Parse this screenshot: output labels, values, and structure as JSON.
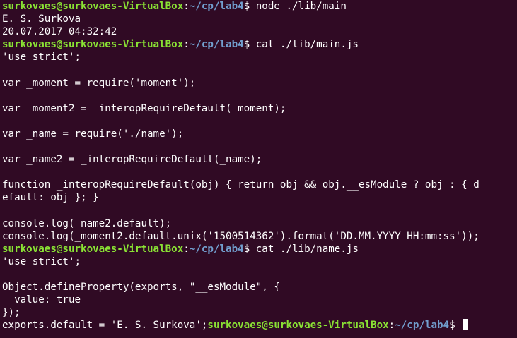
{
  "terminal": {
    "prompt": {
      "user_host": "surkovaes@surkovaes-VirtualBox",
      "path": "~/cp/lab4"
    },
    "lines": [
      {
        "type": "prompt",
        "cmd": "node ./lib/main"
      },
      {
        "type": "output",
        "text": "E. S. Surkova"
      },
      {
        "type": "output",
        "text": "20.07.2017 04:32:42"
      },
      {
        "type": "prompt",
        "cmd": "cat ./lib/main.js"
      },
      {
        "type": "output",
        "text": "'use strict';"
      },
      {
        "type": "output",
        "text": ""
      },
      {
        "type": "output",
        "text": "var _moment = require('moment');"
      },
      {
        "type": "output",
        "text": ""
      },
      {
        "type": "output",
        "text": "var _moment2 = _interopRequireDefault(_moment);"
      },
      {
        "type": "output",
        "text": ""
      },
      {
        "type": "output",
        "text": "var _name = require('./name');"
      },
      {
        "type": "output",
        "text": ""
      },
      {
        "type": "output",
        "text": "var _name2 = _interopRequireDefault(_name);"
      },
      {
        "type": "output",
        "text": ""
      },
      {
        "type": "output",
        "text": "function _interopRequireDefault(obj) { return obj && obj.__esModule ? obj : { d"
      },
      {
        "type": "output",
        "text": "efault: obj }; }"
      },
      {
        "type": "output",
        "text": ""
      },
      {
        "type": "output",
        "text": "console.log(_name2.default);"
      },
      {
        "type": "output",
        "text": "console.log(_moment2.default.unix('1500514362').format('DD.MM.YYYY HH:mm:ss'));"
      },
      {
        "type": "prompt",
        "cmd": "cat ./lib/name.js"
      },
      {
        "type": "output",
        "text": "'use strict';"
      },
      {
        "type": "output",
        "text": ""
      },
      {
        "type": "output",
        "text": "Object.defineProperty(exports, \"__esModule\", {"
      },
      {
        "type": "output",
        "text": "  value: true"
      },
      {
        "type": "output",
        "text": "});"
      },
      {
        "type": "final",
        "text": "exports.default = 'E. S. Surkova';",
        "cmd": ""
      }
    ]
  }
}
